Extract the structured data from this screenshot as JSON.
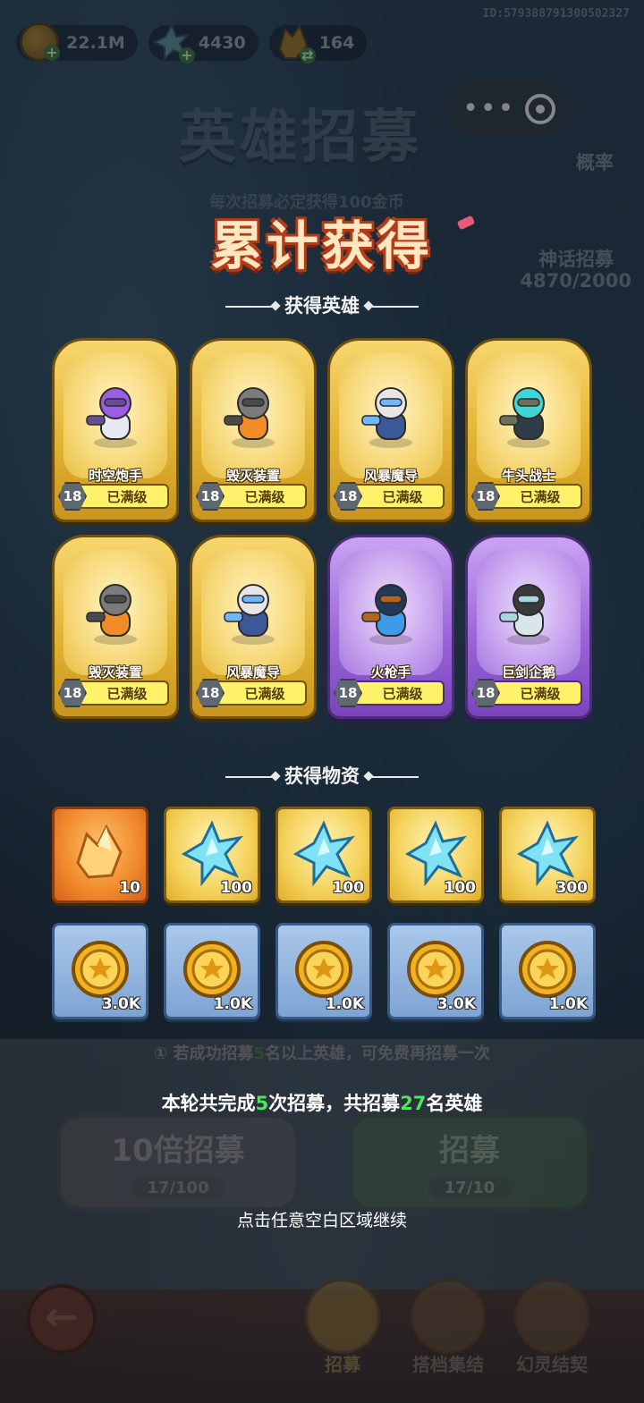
{
  "resources": [
    {
      "name": "coin",
      "value": "22.1M"
    },
    {
      "name": "crystal",
      "value": "4430"
    },
    {
      "name": "shard",
      "value": "164"
    }
  ],
  "uid": "ID:579388791300502327",
  "header": {
    "title": "英雄招募",
    "subtitle": "每次招募必定获得100金币",
    "probability_label": "概率",
    "mythic_label": "神话招募",
    "mythic_progress": "4870/2000"
  },
  "modal": {
    "title": "累计获得",
    "heroes_section": "获得英雄",
    "items_section": "获得物资",
    "heroes": [
      {
        "name": "时空炮手",
        "level": "18",
        "status": "已满级",
        "rarity": "gold"
      },
      {
        "name": "毁灭装置",
        "level": "18",
        "status": "已满级",
        "rarity": "gold"
      },
      {
        "name": "风暴魔导",
        "level": "18",
        "status": "已满级",
        "rarity": "gold"
      },
      {
        "name": "牛头战士",
        "level": "18",
        "status": "已满级",
        "rarity": "gold"
      },
      {
        "name": "毁灭装置",
        "level": "18",
        "status": "已满级",
        "rarity": "gold"
      },
      {
        "name": "风暴魔导",
        "level": "18",
        "status": "已满级",
        "rarity": "gold"
      },
      {
        "name": "火枪手",
        "level": "18",
        "status": "已满级",
        "rarity": "purple"
      },
      {
        "name": "巨剑企鹅",
        "level": "18",
        "status": "已满级",
        "rarity": "purple"
      }
    ],
    "items_row1": [
      {
        "icon": "orange-crystal-icon",
        "qty": "10"
      },
      {
        "icon": "blue-crystal-icon",
        "qty": "100"
      },
      {
        "icon": "blue-crystal-icon",
        "qty": "100"
      },
      {
        "icon": "blue-crystal-icon",
        "qty": "100"
      },
      {
        "icon": "blue-crystal-icon",
        "qty": "300"
      }
    ],
    "items_row2": [
      {
        "icon": "gold-coin-icon",
        "qty": "3.0K"
      },
      {
        "icon": "gold-coin-icon",
        "qty": "1.0K"
      },
      {
        "icon": "gold-coin-icon",
        "qty": "1.0K"
      },
      {
        "icon": "gold-coin-icon",
        "qty": "3.0K"
      },
      {
        "icon": "gold-coin-icon",
        "qty": "1.0K"
      }
    ],
    "summary": {
      "pre": "本轮共完成",
      "rounds": "5",
      "mid": "次招募，共招募",
      "heroes": "27",
      "post": "名英雄"
    },
    "continue": "点击任意空白区域继续"
  },
  "background": {
    "notice_pre": "① 若成功招募",
    "notice_num": "5",
    "notice_post": "名以上英雄，可免费再招募一次",
    "btn_10": {
      "label": "10倍招募",
      "count": "17/100"
    },
    "btn_1": {
      "label": "招募",
      "count": "17/10"
    },
    "nav": [
      "招募",
      "搭档集结",
      "幻灵结契"
    ]
  }
}
